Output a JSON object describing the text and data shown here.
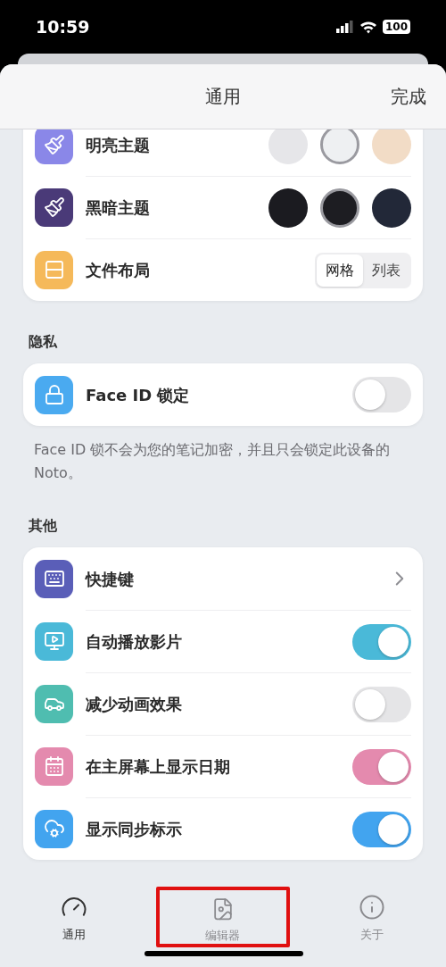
{
  "status_bar": {
    "time": "10:59",
    "battery": "100"
  },
  "header": {
    "title": "通用",
    "done": "完成"
  },
  "sections": [
    {
      "rows": [
        {
          "kind": "swatches",
          "label": "明亮主题",
          "color": "#8a87e8",
          "swatches": [
            {
              "color": "#e6e6e9",
              "selected": false
            },
            {
              "color": "#eef0f2",
              "selected": true
            },
            {
              "color": "#f2dcc6",
              "selected": false
            }
          ]
        },
        {
          "kind": "swatches",
          "label": "黑暗主题",
          "color": "#4a3a78",
          "swatches": [
            {
              "color": "#1b1b20",
              "selected": false
            },
            {
              "color": "#1d1d22",
              "selected": true
            },
            {
              "color": "#222838",
              "selected": false
            }
          ]
        },
        {
          "kind": "segmented",
          "label": "文件布局",
          "color": "#f5b95a",
          "options": [
            {
              "label": "网格",
              "selected": true
            },
            {
              "label": "列表",
              "selected": false
            }
          ]
        }
      ]
    },
    {
      "heading": "隐私",
      "footnote": "Face ID 锁不会为您的笔记加密，并且只会锁定此设备的Noto。",
      "rows": [
        {
          "kind": "toggle",
          "label": "Face ID 锁定",
          "color": "#4aaaf0",
          "on": false
        }
      ]
    },
    {
      "heading": "其他",
      "rows": [
        {
          "kind": "link",
          "label": "快捷键",
          "color": "#5a5eb8"
        },
        {
          "kind": "toggle",
          "label": "自动播放影片",
          "color": "#4ab9d8",
          "on": true
        },
        {
          "kind": "toggle",
          "label": "减少动画效果",
          "color": "#4fbdb0",
          "on": false
        },
        {
          "kind": "toggle",
          "label": "在主屏幕上显示日期",
          "color": "#e48aae",
          "on": true
        },
        {
          "kind": "toggle",
          "label": "显示同步标示",
          "color": "#42a4ef",
          "on": true
        }
      ]
    }
  ],
  "tab_bar": [
    {
      "label": "通用",
      "selected": true,
      "highlighted": false
    },
    {
      "label": "编辑器",
      "selected": false,
      "highlighted": true
    },
    {
      "label": "关于",
      "selected": false,
      "highlighted": false
    }
  ]
}
